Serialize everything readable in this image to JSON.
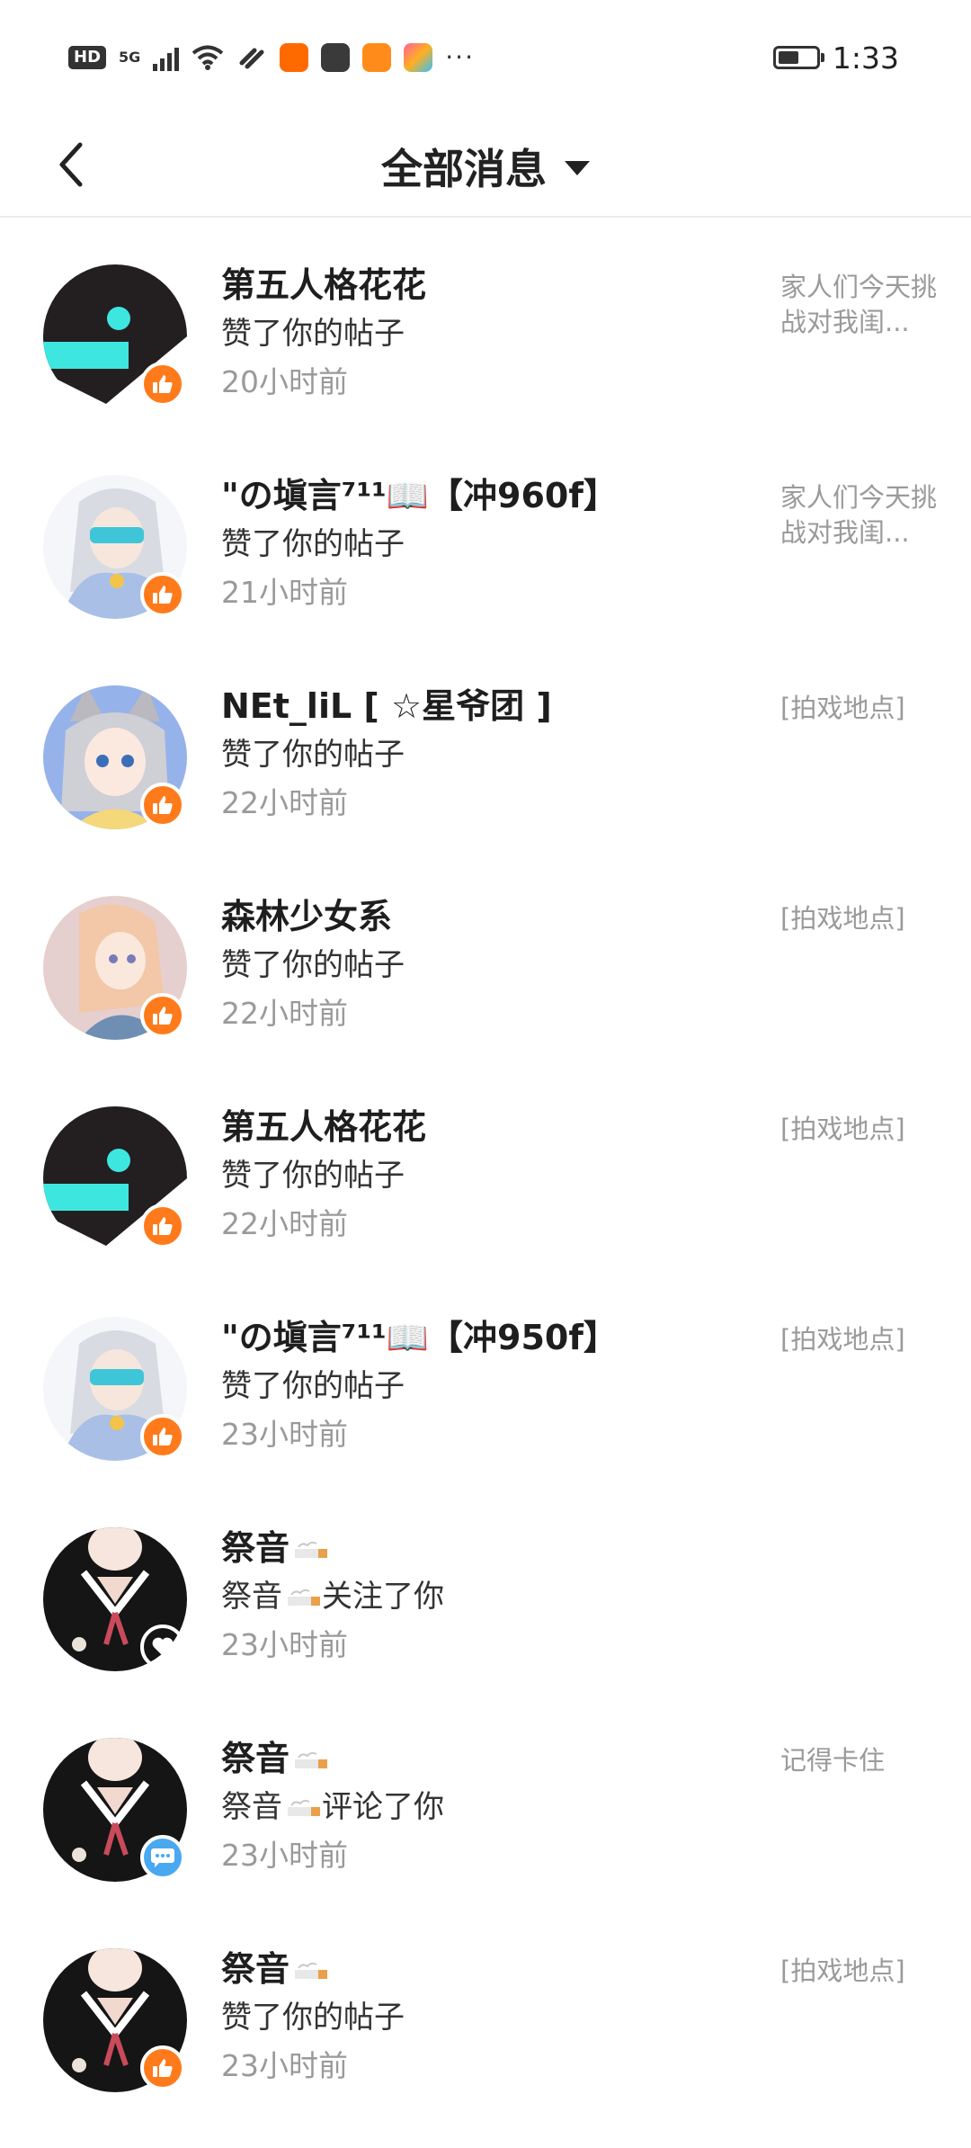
{
  "status_bar": {
    "hd": "HD",
    "network": "5G",
    "more": "···",
    "time": "1:33",
    "battery_level": 0.55,
    "app_icons": [
      "taobao-icon",
      "mail-icon",
      "video-icon",
      "app-icon"
    ]
  },
  "header": {
    "title": "全部消息"
  },
  "messages": [
    {
      "name": "第五人格花花",
      "action": "赞了你的帖子",
      "time": "20小时前",
      "snippet": "家人们今天挑战对我闺...",
      "type": "like",
      "avatar": "dark-logo"
    },
    {
      "name": "\"の塡言⁷¹¹📖【冲960f】",
      "action": "赞了你的帖子",
      "time": "21小时前",
      "snippet": "家人们今天挑战对我闺...",
      "type": "like",
      "avatar": "anime-silver"
    },
    {
      "name": "NEt_liL [ ☆星爷团 ]",
      "action": "赞了你的帖子",
      "time": "22小时前",
      "snippet": "[拍戏地点]",
      "type": "like",
      "avatar": "anime-catgirl"
    },
    {
      "name": "森林少女系",
      "action": "赞了你的帖子",
      "time": "22小时前",
      "snippet": "[拍戏地点]",
      "type": "like",
      "avatar": "anime-pink"
    },
    {
      "name": "第五人格花花",
      "action": "赞了你的帖子",
      "time": "22小时前",
      "snippet": "[拍戏地点]",
      "type": "like",
      "avatar": "dark-logo"
    },
    {
      "name": "\"の塡言⁷¹¹📖【冲950f】",
      "action": "赞了你的帖子",
      "time": "23小时前",
      "snippet": "[拍戏地点]",
      "type": "like",
      "avatar": "anime-silver"
    },
    {
      "name": "祭音",
      "action_prefix": "祭音",
      "action": "关注了你",
      "time": "23小时前",
      "snippet": "",
      "type": "follow",
      "avatar": "girl-dark"
    },
    {
      "name": "祭音",
      "action_prefix": "祭音",
      "action": "评论了你",
      "time": "23小时前",
      "snippet": "记得卡住",
      "type": "comment",
      "avatar": "girl-dark"
    },
    {
      "name": "祭音",
      "action": "赞了你的帖子",
      "time": "23小时前",
      "snippet": "[拍戏地点]",
      "type": "like",
      "avatar": "girl-dark"
    }
  ],
  "colors": {
    "like_badge": "#ff7a1a",
    "follow_badge": "#ffb12a",
    "comment_badge": "#4aa8f0",
    "avatar_accent": "#3de0e0"
  }
}
